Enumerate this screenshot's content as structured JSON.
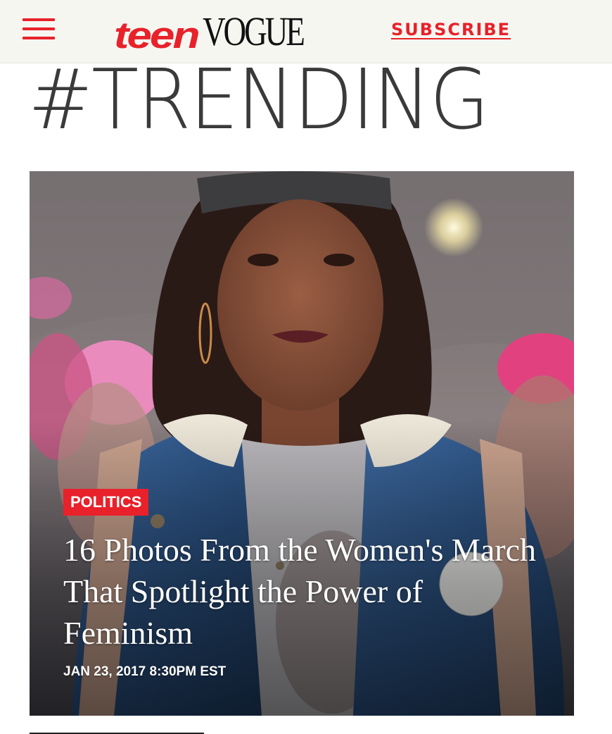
{
  "header": {
    "menu_icon": "hamburger-menu-icon",
    "logo_part1": "teen",
    "logo_part2": "VOGUE",
    "subscribe_label": "SUBSCRIBE",
    "colors": {
      "brand_red": "#e8212a",
      "bar_bg": "#f6f6f1"
    }
  },
  "section": {
    "heading": "#TRENDING"
  },
  "featured": {
    "category": "POLITICS",
    "headline": "16 Photos From the Women's March That Spotlight the Power of Feminism",
    "date": "JAN 23, 2017 8:30PM EST"
  }
}
